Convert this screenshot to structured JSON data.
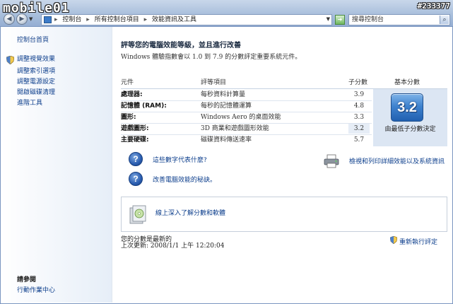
{
  "watermark": {
    "brand": "mobile01",
    "id": "#233377"
  },
  "address_bar": {
    "crumbs": [
      "控制台",
      "所有控制台項目",
      "效能資訊及工具"
    ],
    "search_placeholder": "搜尋控制台"
  },
  "sidebar": {
    "home": "控制台首頁",
    "items": [
      "調整視覺效果",
      "調整索引選項",
      "調整電源設定",
      "開啟磁碟清理",
      "進階工具"
    ],
    "see_also_title": "請參閱",
    "see_also_items": [
      "行動作業中心"
    ]
  },
  "main": {
    "title": "評等您的電腦效能等級，並且進行改善",
    "description": "Windows 體驗指數會以 1.0 到 7.9 的分數評定重要系統元件。",
    "headers": {
      "component": "元件",
      "rated": "評等項目",
      "subscore": "子分數",
      "base": "基本分數"
    },
    "rows": [
      {
        "component": "處理器:",
        "desc": "每秒資料計算量",
        "score": "3.9"
      },
      {
        "component": "記憶體 (RAM):",
        "desc": "每秒的記憶體運算",
        "score": "4.8"
      },
      {
        "component": "圖形:",
        "desc": "Windows Aero 的桌面效能",
        "score": "3.3"
      },
      {
        "component": "遊戲圖形:",
        "desc": "3D 商業和遊戲圖形效能",
        "score": "3.2"
      },
      {
        "component": "主要硬碟:",
        "desc": "磁碟資料傳送速率",
        "score": "5.7"
      }
    ],
    "base_score": "3.2",
    "base_note": "由最低子分數決定",
    "help_links": [
      "這些數字代表什麼?",
      "改善電腦效能的秘訣。"
    ],
    "print_link": "檢視和列印詳細效能以及系統資訊",
    "online_link": "線上深入了解分數和軟體",
    "status_line1": "您的分數是最新的",
    "status_line2": "上次更新: 2008/1/1 上午 12:20:04",
    "rerun_link": "重新執行評定"
  }
}
